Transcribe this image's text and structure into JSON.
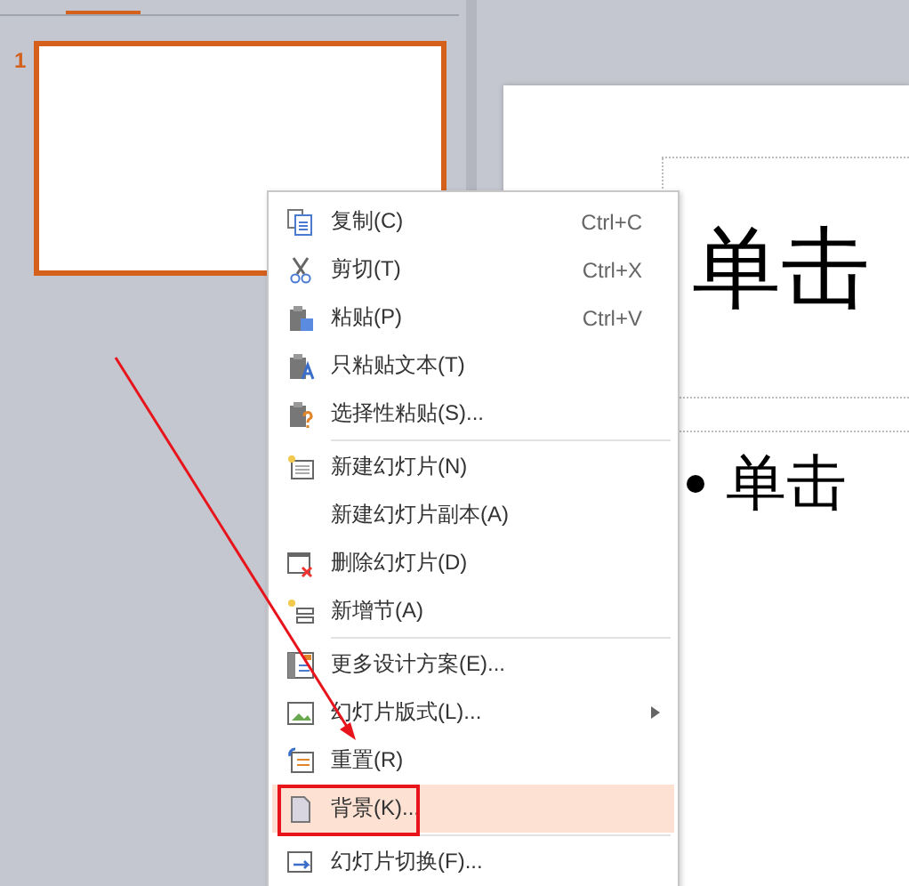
{
  "thumbnails": [
    {
      "number": "1",
      "selected": true
    }
  ],
  "slide": {
    "title": "单击",
    "body": "单击"
  },
  "context_menu": [
    {
      "kind": "item",
      "label": "复制(C)",
      "shortcut": "Ctrl+C",
      "selected": false
    },
    {
      "kind": "item",
      "label": "剪切(T)",
      "shortcut": "Ctrl+X",
      "selected": false
    },
    {
      "kind": "item",
      "label": "粘贴(P)",
      "shortcut": "Ctrl+V",
      "selected": false
    },
    {
      "kind": "item",
      "label": "只粘贴文本(T)",
      "selected": false
    },
    {
      "kind": "item",
      "label": "选择性粘贴(S)...",
      "selected": false
    },
    {
      "kind": "separator"
    },
    {
      "kind": "item",
      "label": "新建幻灯片(N)",
      "selected": false
    },
    {
      "kind": "item",
      "label": "新建幻灯片副本(A)",
      "selected": false
    },
    {
      "kind": "item",
      "label": "删除幻灯片(D)",
      "selected": false
    },
    {
      "kind": "item",
      "label": "新增节(A)",
      "selected": false
    },
    {
      "kind": "separator"
    },
    {
      "kind": "item",
      "label": "更多设计方案(E)...",
      "selected": false
    },
    {
      "kind": "item",
      "label": "幻灯片版式(L)...",
      "submenu": true,
      "selected": false
    },
    {
      "kind": "item",
      "label": "重置(R)",
      "selected": false
    },
    {
      "kind": "item",
      "label": "背景(K)...",
      "selected": true,
      "outlined": true
    },
    {
      "kind": "separator"
    },
    {
      "kind": "item",
      "label": "幻灯片切换(F)...",
      "selected": false
    }
  ]
}
